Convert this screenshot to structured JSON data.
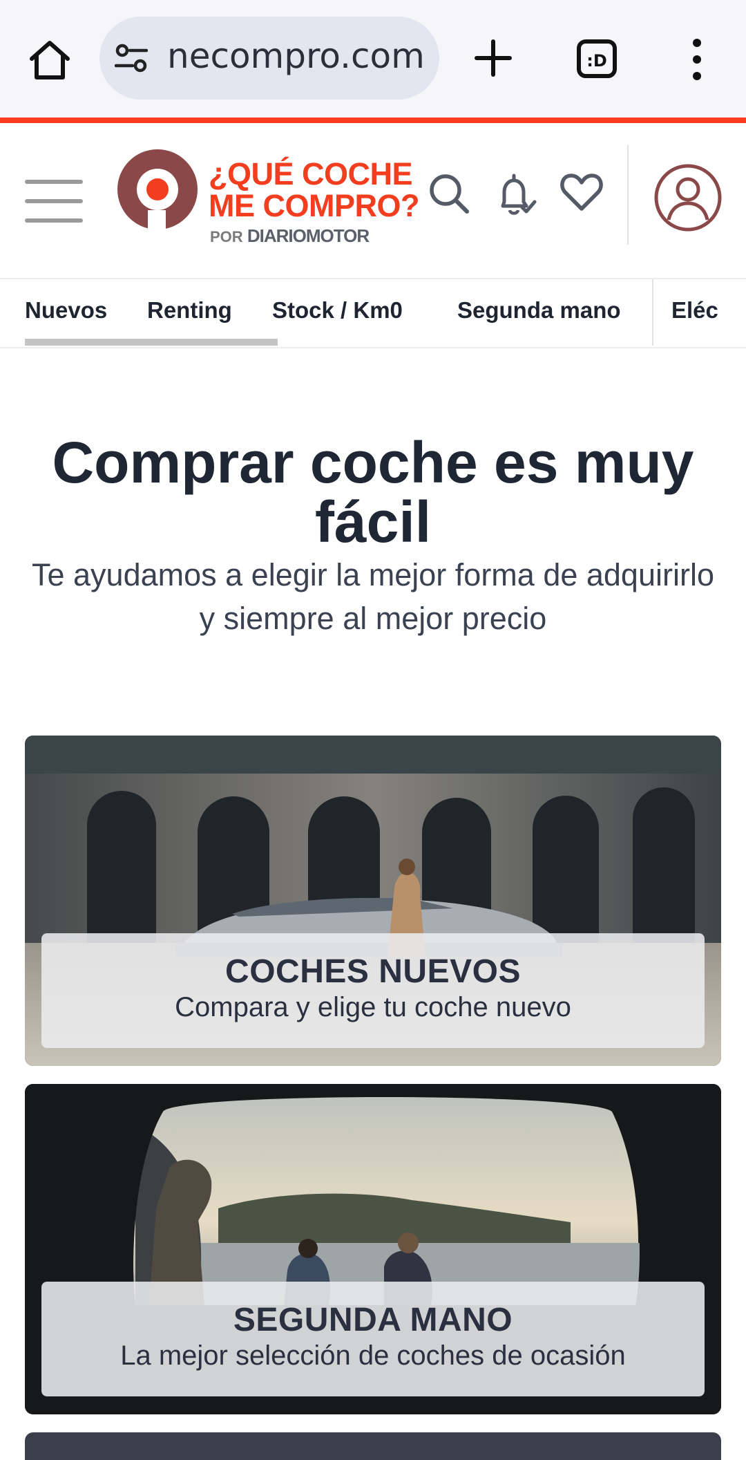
{
  "browser": {
    "url": "necompro.com",
    "tab_count_badge": ":D"
  },
  "brand": {
    "line1": "¿QUÉ COCHE",
    "line2": "ME COMPRO?",
    "by_prefix": "POR",
    "by_name": "DIARIOMOTOR",
    "color": "#f23d1f"
  },
  "nav": {
    "items": [
      {
        "label": "Nuevos"
      },
      {
        "label": "Renting"
      },
      {
        "label": "Stock / Km0"
      },
      {
        "label": "Segunda mano"
      },
      {
        "label": "Eléc"
      }
    ]
  },
  "hero": {
    "title": "Comprar coche es muy fácil",
    "subtitle": "Te ayudamos a elegir la mejor forma de adquirirlo y siempre al mejor precio"
  },
  "cards": [
    {
      "title": "COCHES NUEVOS",
      "subtitle": "Compara y elige tu coche nuevo"
    },
    {
      "title": "SEGUNDA MANO",
      "subtitle": "La mejor selección de coches de ocasión"
    }
  ],
  "icons": {
    "home": "home-icon",
    "site_settings": "tune-icon",
    "new_tab": "plus-icon",
    "tabs": "tab-switcher-icon",
    "menu": "more-vert-icon",
    "hamburger": "hamburger-menu-icon",
    "search": "search-icon",
    "notifications": "bell-icon",
    "favorites": "heart-icon",
    "account": "user-avatar-icon"
  }
}
